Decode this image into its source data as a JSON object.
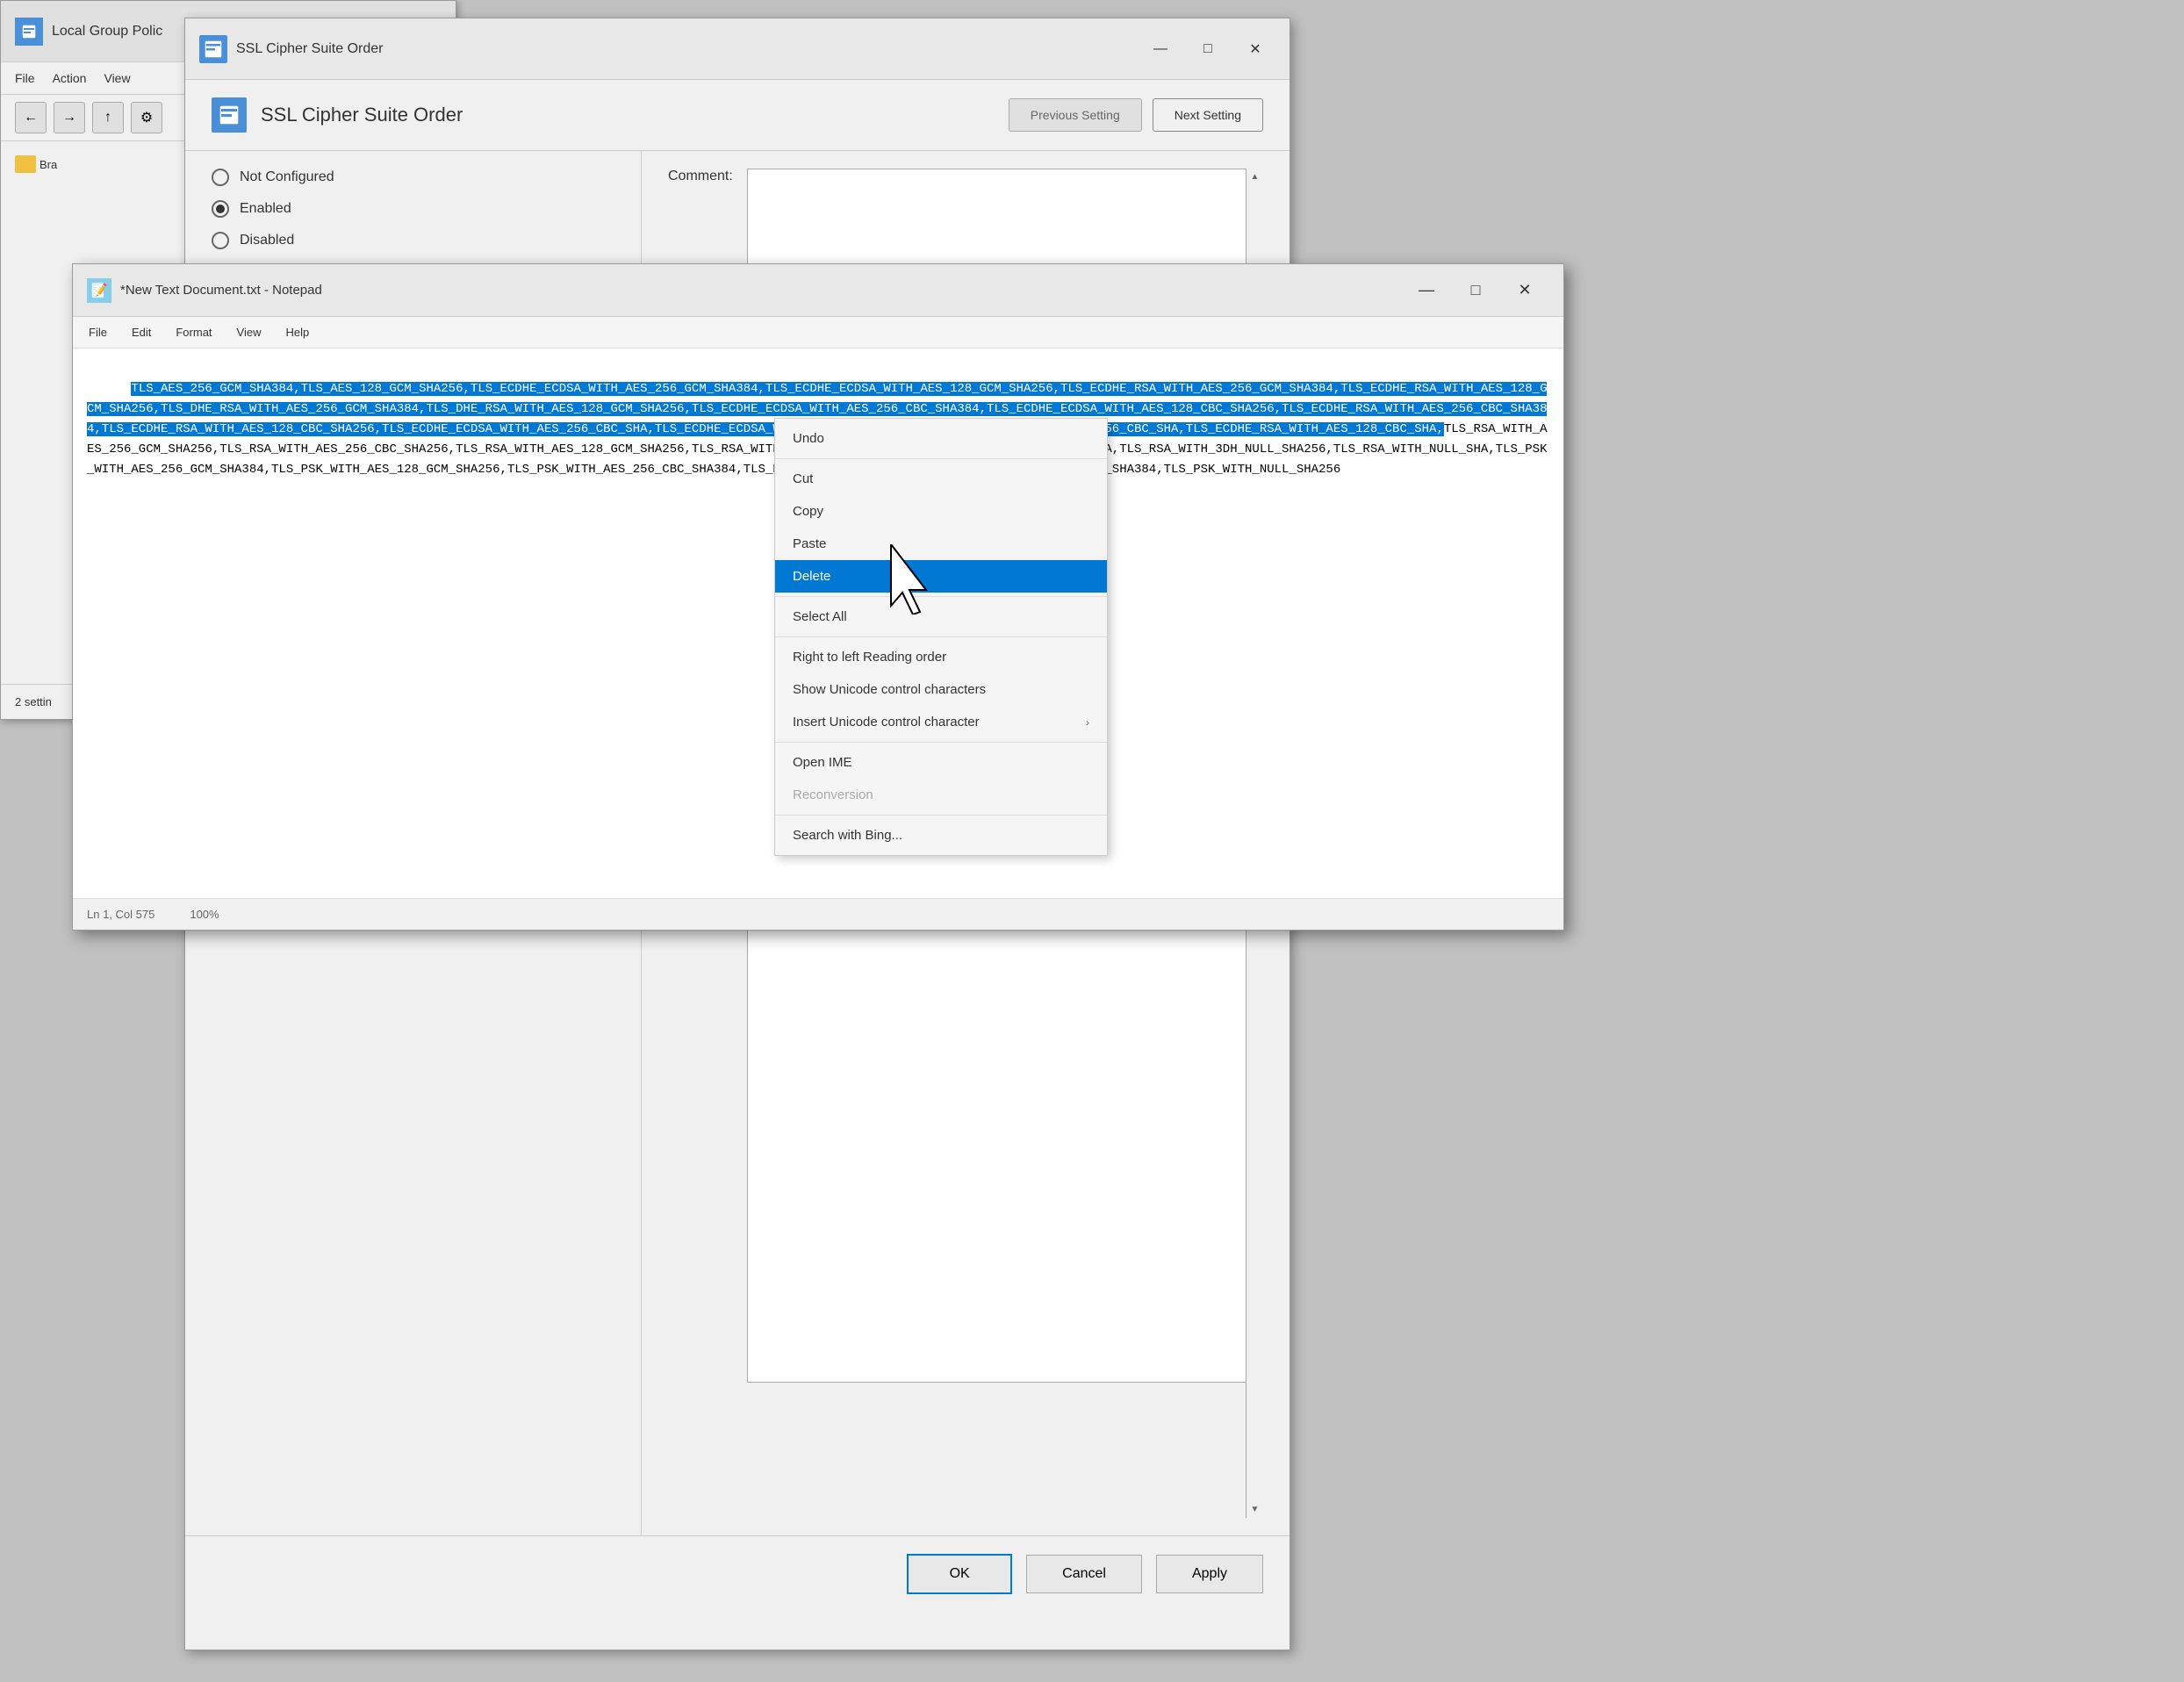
{
  "lgp": {
    "title": "Local Group Polic",
    "menu": [
      "File",
      "Action",
      "View"
    ],
    "breadcrumb": "Bra",
    "status": "2 settin"
  },
  "ssl_dialog": {
    "title": "SSL Cipher Suite Order",
    "header_title": "SSL Cipher Suite Order",
    "prev_btn": "Previous Setting",
    "next_btn": "Next Setting",
    "not_configured": "Not Configured",
    "enabled": "Enabled",
    "disabled_label": "Disabled",
    "comment_label": "Comment:",
    "ok_btn": "OK",
    "cancel_btn": "Cancel",
    "apply_btn": "Apply",
    "win_minimize": "—",
    "win_maximize": "□",
    "win_close": "✕"
  },
  "notepad": {
    "title": "*New Text Document.txt - Notepad",
    "icon": "📝",
    "menu": [
      "File",
      "Edit",
      "Format",
      "View",
      "Help"
    ],
    "win_minimize": "—",
    "win_maximize": "□",
    "win_close": "✕",
    "selected_text": "TLS_AES_256_GCM_SHA384,TLS_AES_128_GCM_SHA256,TLS_ECDHE_ECDSA_WITH_AES_256_GCM_SHA384,TLS_ECDHE_ECDSA_WITH_AES_128_GCM_SHA256,TLS_ECDHE_RSA_WITH_AES_256_GCM_SHA384,TLS_ECDHE_RSA_WITH_AES_128_GCM_SHA256,TLS_DHE_RSA_WITH_AES_256_GCM_SHA384,TLS_DHE_RSA_WITH_AES_128_GCM_SHA256,TLS_ECDHE_ECDSA_WITH_AES_256_CBC_SHA384,TLS_ECDHE_ECDSA_WITH_AES_128_CBC_SHA256,TLS_ECDHE_RSA_WITH_AES_256_CBC_SHA384,TLS_ECDHE_RSA_WITH_AES_128_CBC_SHA256,TLS_ECDHE_ECDSA_WITH_AES_256_CBC_SHA,TLS_ECDHE_ECDSA_WITH_AES_128_CBC_SHA,TLS_ECDHE_RSA_WITH_AES_256_CBC_SHA,TLS_ECDHE_RSA_WITH_AES_128_CBC_SHA,",
    "normal_text": "TLS_RSA_WITH_AES_256_GCM_SHA256,TLS_RSA_WITH_AES_256_CBC_SHA256,TLS_RSA_WITH_AES_128_GCM_SHA256,TLS_RSA_WITH_AES_256_CBC_SHA,TLS_RSA_WITH_AES_128_CBC_SHA,TLS_RSA_WITH_3DH_NULL_SHA256,TLS_RSA_WITH_NULL_SHA,TLS_PSK_WITH_AES_256_GCM_SHA384,TLS_PSK_WITH_AES_128_GCM_SHA256,TLS_PSK_WITH_AES_256_CBC_SHA384,TLS_PSK_WITH_AES_128_CBC_SHA256,TLS_PSK_WITH_NULL_SHA384,TLS_PSK_WITH_NULL_SHA256",
    "status_ln": "Ln 1, Col 575",
    "status_zoom": "100%"
  },
  "context_menu": {
    "items": [
      {
        "label": "Undo",
        "enabled": true,
        "highlighted": false
      },
      {
        "label": "Cut",
        "enabled": true,
        "highlighted": false
      },
      {
        "label": "Copy",
        "enabled": true,
        "highlighted": false
      },
      {
        "label": "Paste",
        "enabled": true,
        "highlighted": false
      },
      {
        "label": "Delete",
        "enabled": true,
        "highlighted": true
      },
      {
        "label": "Select All",
        "enabled": true,
        "highlighted": false
      },
      {
        "label": "Right to left Reading order",
        "enabled": true,
        "highlighted": false,
        "sep_before": true
      },
      {
        "label": "Show Unicode control characters",
        "enabled": true,
        "highlighted": false
      },
      {
        "label": "Insert Unicode control character",
        "enabled": true,
        "highlighted": false,
        "has_arrow": true
      },
      {
        "label": "Open IME",
        "enabled": true,
        "highlighted": false,
        "sep_before": true
      },
      {
        "label": "Reconversion",
        "enabled": false,
        "highlighted": false
      },
      {
        "label": "Search with Bing...",
        "enabled": true,
        "highlighted": false,
        "sep_before": true
      }
    ]
  },
  "colors": {
    "selection_bg": "#0078d4",
    "highlight_bg": "#0078d4",
    "window_bg": "#f0f0f0",
    "titlebar_bg": "#e8e8e8"
  }
}
